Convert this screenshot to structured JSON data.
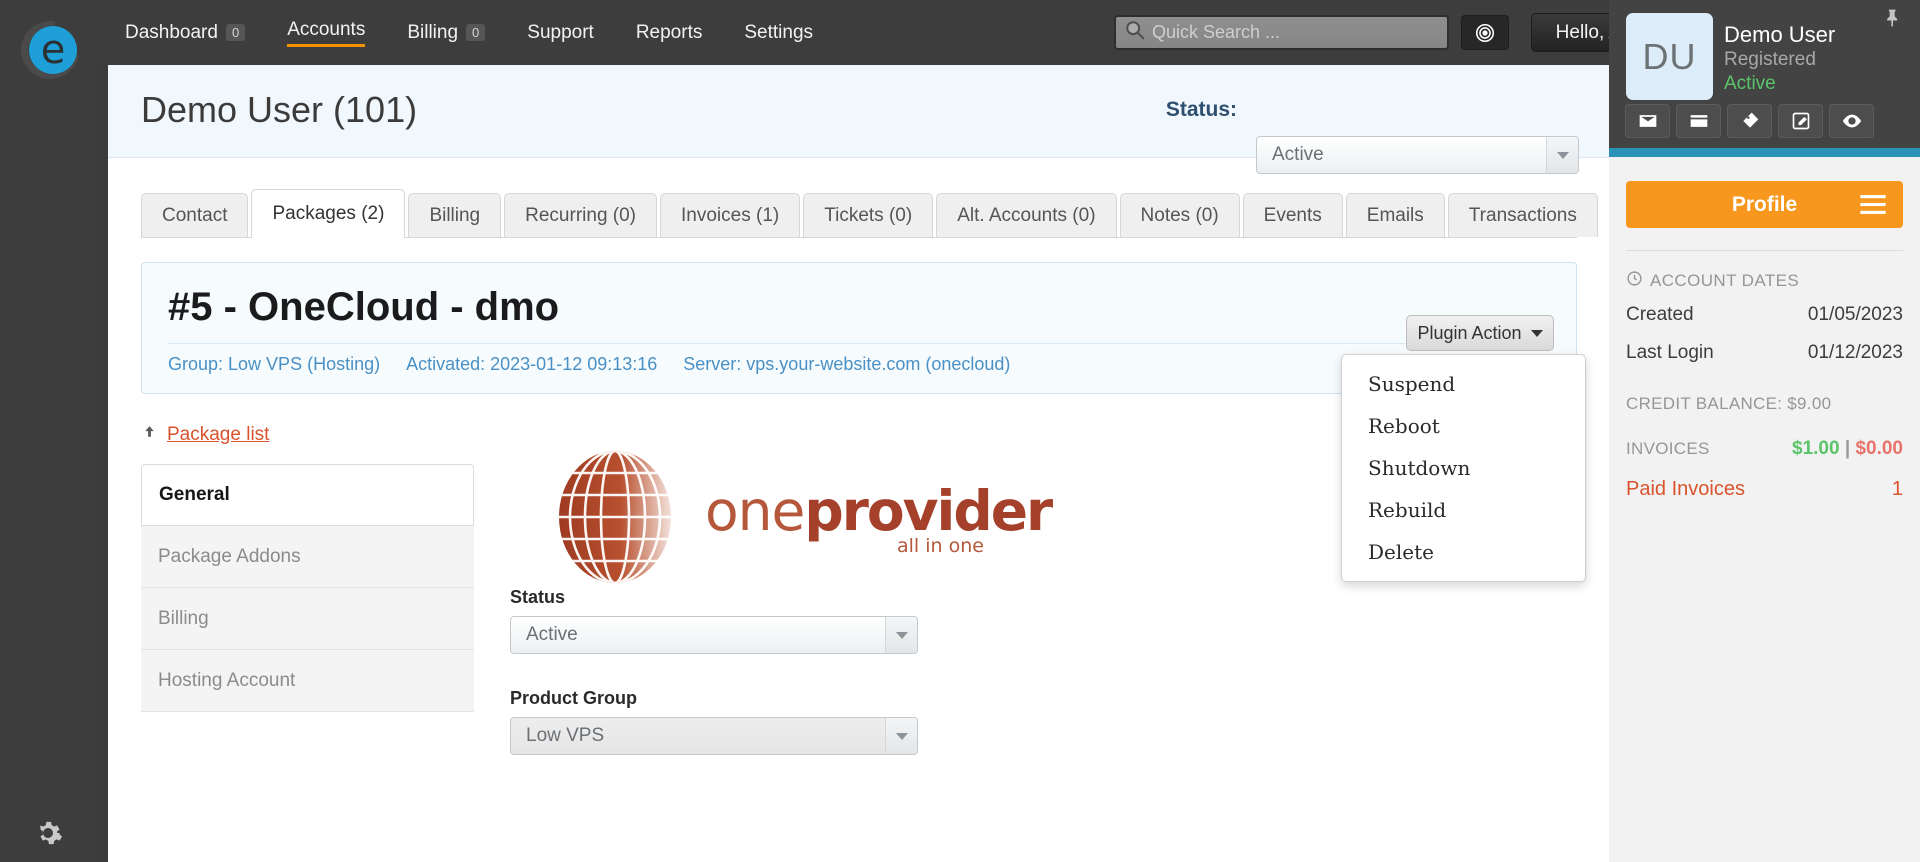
{
  "topnav": {
    "items": [
      {
        "label": "Dashboard",
        "badge": "0",
        "active": false
      },
      {
        "label": "Accounts",
        "badge": "",
        "active": true
      },
      {
        "label": "Billing",
        "badge": "0",
        "active": false
      },
      {
        "label": "Support",
        "badge": "",
        "active": false
      },
      {
        "label": "Reports",
        "badge": "",
        "active": false
      },
      {
        "label": "Settings",
        "badge": "",
        "active": false
      }
    ],
    "search_placeholder": "Quick Search ...",
    "search_value": "",
    "target_icon": "target-icon",
    "admin_label": "Hello, Admin"
  },
  "rail": {
    "logo_letter": "e",
    "gear_icon": "gear-icon"
  },
  "page": {
    "title": "Demo User (101)",
    "status_label": "Status:",
    "status_value": "Active"
  },
  "tabs": [
    {
      "label": "Contact",
      "active": false
    },
    {
      "label": "Packages (2)",
      "active": true
    },
    {
      "label": "Billing",
      "active": false
    },
    {
      "label": "Recurring (0)",
      "active": false
    },
    {
      "label": "Invoices (1)",
      "active": false
    },
    {
      "label": "Tickets (0)",
      "active": false
    },
    {
      "label": "Alt. Accounts (0)",
      "active": false
    },
    {
      "label": "Notes (0)",
      "active": false
    },
    {
      "label": "Events",
      "active": false
    },
    {
      "label": "Emails",
      "active": false
    },
    {
      "label": "Transactions",
      "active": false
    }
  ],
  "package": {
    "title": "#5 - OneCloud - dmo",
    "links": [
      "Group: Low VPS (Hosting)",
      "Activated: 2023-01-12 09:13:16",
      "Server: vps.your-website.com (onecloud)"
    ],
    "plugin_action_label": "Plugin Action",
    "plugin_menu": [
      "Suspend",
      "Reboot",
      "Shutdown",
      "Rebuild",
      "Delete"
    ]
  },
  "subnav": {
    "package_list_label": "Package list",
    "items": [
      {
        "label": "General",
        "active": true
      },
      {
        "label": "Package Addons",
        "active": false
      },
      {
        "label": "Billing",
        "active": false
      },
      {
        "label": "Hosting Account",
        "active": false
      }
    ]
  },
  "brand": {
    "word1": "one",
    "word2": "provider",
    "tagline": "all in one"
  },
  "form": {
    "status_label": "Status",
    "status_value": "Active",
    "product_group_label": "Product Group",
    "product_group_value": "Low VPS"
  },
  "sidebar": {
    "avatar_initials": "DU",
    "user_name": "Demo User",
    "user_type": "Registered",
    "user_status": "Active",
    "action_icons": [
      "envelope-icon",
      "credit-card-icon",
      "ticket-icon",
      "edit-icon",
      "eye-icon"
    ],
    "profile_label": "Profile",
    "account_dates_title": "ACCOUNT DATES",
    "created_label": "Created",
    "created_value": "01/05/2023",
    "last_login_label": "Last Login",
    "last_login_value": "01/12/2023",
    "credit_balance": "CREDIT BALANCE: $9.00",
    "invoices_label": "INVOICES",
    "invoices_paid": "$1.00",
    "invoices_sep": "|",
    "invoices_due": "$0.00",
    "paid_invoices_label": "Paid Invoices",
    "paid_invoices_count": "1"
  },
  "colors": {
    "accent_orange": "#f7971e",
    "link_orange": "#d9532c",
    "teal": "#2b93b8",
    "green": "#5bc46a",
    "red": "#e8726a",
    "brand_red": "#a5412b"
  }
}
